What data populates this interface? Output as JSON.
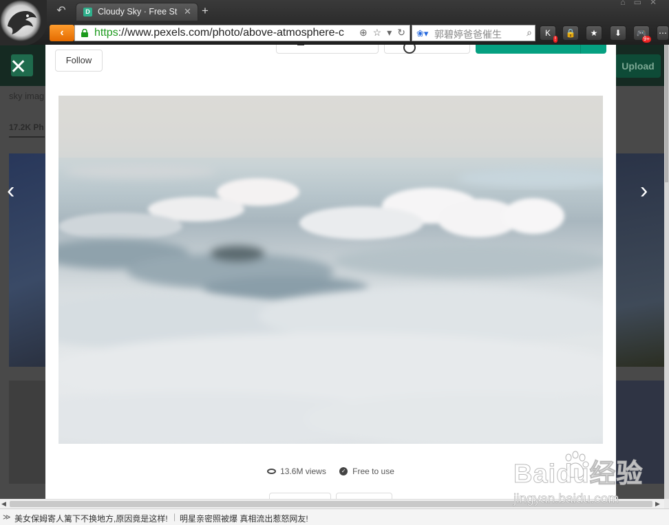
{
  "browser": {
    "tab": {
      "favicon": "D",
      "title": "Cloudy Sky · Free St"
    },
    "address": {
      "protocol": "https",
      "rest": "://www.pexels.com/photo/above-atmosphere-c"
    },
    "search": {
      "text": "郭碧婷爸爸催生"
    },
    "extensions": [
      {
        "label": "K",
        "badge": "!"
      },
      {
        "label": "🔒"
      },
      {
        "label": "★"
      },
      {
        "label": "⬇"
      },
      {
        "label": "🎮",
        "badge": "9+"
      },
      {
        "label": "⋯"
      }
    ]
  },
  "background": {
    "upload_label": "Upload",
    "search_label": "sky imag",
    "count_label": "17.2K Ph"
  },
  "modal": {
    "follow_label": "Follow",
    "photo_alt": "Cloudy sky above the clouds",
    "stats": {
      "views": "13.6M views",
      "license": "Free to use"
    }
  },
  "statusbar": {
    "news1": "美女保姆寄人篱下不换地方,原因竟是这样!",
    "news2": "明星亲密照被爆 真相流出惹怒网友!"
  },
  "watermark": {
    "logo": "Baidu经验",
    "url": "jingyan.baidu.com"
  },
  "colors": {
    "accent_orange": "#f07c10",
    "pexels_green": "#05a081",
    "secure_green": "#1d9a1d"
  }
}
